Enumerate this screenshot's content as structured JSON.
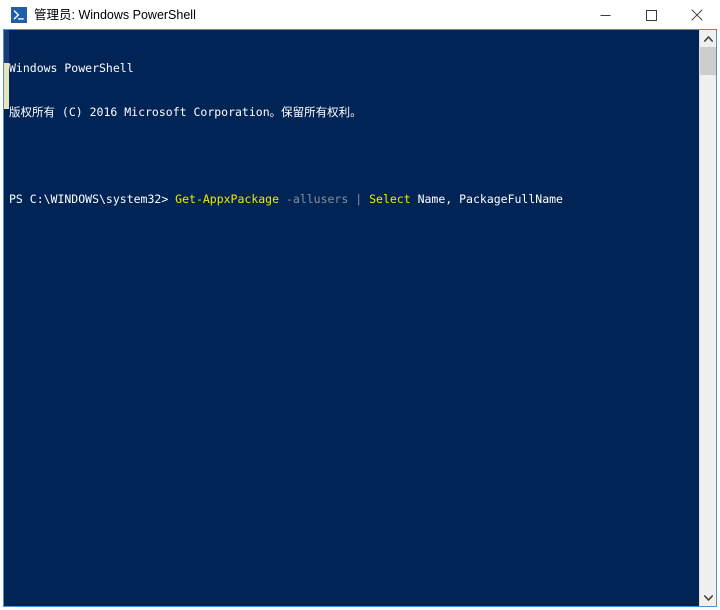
{
  "window": {
    "title": "管理员: Windows PowerShell",
    "icon": "powershell-icon",
    "controls": {
      "minimize_label": "最小化",
      "maximize_label": "最大化",
      "close_label": "关闭"
    }
  },
  "console": {
    "background_color": "#012456",
    "foreground_color": "#ffffff",
    "accent_yellow": "#f2e900",
    "accent_gray": "#8b8f96",
    "lines": [
      {
        "id": "banner",
        "text": "Windows PowerShell"
      },
      {
        "id": "copyright",
        "text": "版权所有 (C) 2016 Microsoft Corporation。保留所有权利。"
      },
      {
        "id": "blank",
        "text": ""
      }
    ],
    "prompt": {
      "path": "PS C:\\WINDOWS\\system32> ",
      "cmdlet": "Get-AppxPackage",
      "space1": " ",
      "parameter": "-allusers",
      "space2": " ",
      "pipe": "|",
      "space3": " ",
      "cmdlet2": "Select",
      "space4": " ",
      "arguments": "Name, PackageFullName"
    }
  },
  "scrollbar": {
    "up_arrow": "chevron-up-icon",
    "down_arrow": "chevron-down-icon",
    "thumb_label": "scroll-thumb"
  }
}
